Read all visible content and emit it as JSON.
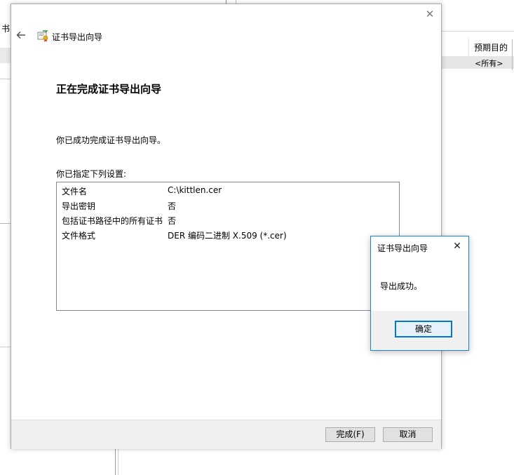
{
  "background": {
    "left_fragment_text": "书",
    "right_table": {
      "column_header": "预期目的",
      "row_value": "<所有>"
    }
  },
  "wizard": {
    "title": "证书导出向导",
    "heading": "正在完成证书导出向导",
    "success_message": "你已成功完成证书导出向导。",
    "settings_label": "你已指定下列设置:",
    "settings": [
      {
        "key": "文件名",
        "value": "C:\\kittlen.cer"
      },
      {
        "key": "导出密钥",
        "value": "否"
      },
      {
        "key": "包括证书路径中的所有证书",
        "value": "否"
      },
      {
        "key": "文件格式",
        "value": "DER 编码二进制 X.509 (*.cer)"
      }
    ],
    "buttons": {
      "finish": "完成(F)",
      "cancel": "取消"
    },
    "icons": {
      "back": "back-arrow-icon",
      "close": "close-icon",
      "certificate": "certificate-icon"
    }
  },
  "message_box": {
    "title": "证书导出向导",
    "message": "导出成功。",
    "ok_label": "确定"
  },
  "colors": {
    "accent": "#0078d7",
    "msgbox_border": "#1883d7",
    "footer_bg": "#f0f0f0",
    "button_bg": "#e1e1e1"
  }
}
